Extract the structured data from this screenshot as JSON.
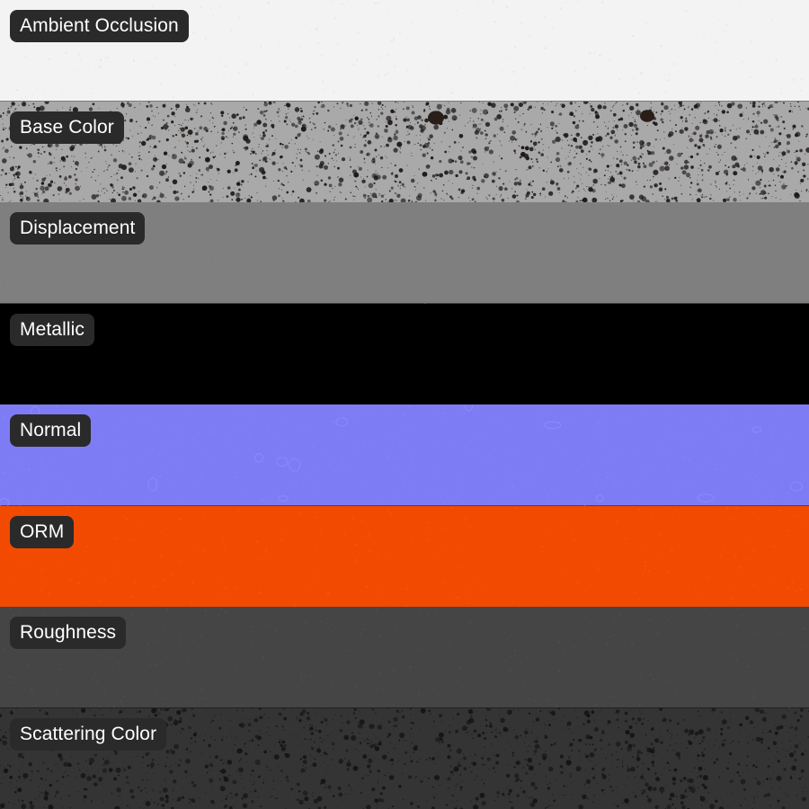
{
  "maps": [
    {
      "label": "Ambient Occlusion",
      "color": "#f3f3f3",
      "icon": "noise-light",
      "speck": "#dcdcdc",
      "speck_count": 260
    },
    {
      "label": "Base Color",
      "color": "#a9a9a9",
      "icon": "speckled-terrazzo",
      "speck": "#1e1a18",
      "speck_count": 2300
    },
    {
      "label": "Displacement",
      "color": "#7f7f7f",
      "icon": "flat",
      "speck": "#7a7a7a",
      "speck_count": 60
    },
    {
      "label": "Metallic",
      "color": "#000000",
      "icon": "flat",
      "speck": "#000000",
      "speck_count": 0
    },
    {
      "label": "Normal",
      "color": "#7e7cf5",
      "icon": "normal-bumps",
      "speck": "#8a88ff",
      "speck_count": 420
    },
    {
      "label": "ORM",
      "color": "#f24a00",
      "icon": "noise",
      "speck": "#ff5a10",
      "speck_count": 520
    },
    {
      "label": "Roughness",
      "color": "#454545",
      "icon": "noise",
      "speck": "#535353",
      "speck_count": 650
    },
    {
      "label": "Scattering Color",
      "color": "#343434",
      "icon": "speckled-dark",
      "speck": "#151515",
      "speck_count": 1600
    }
  ]
}
